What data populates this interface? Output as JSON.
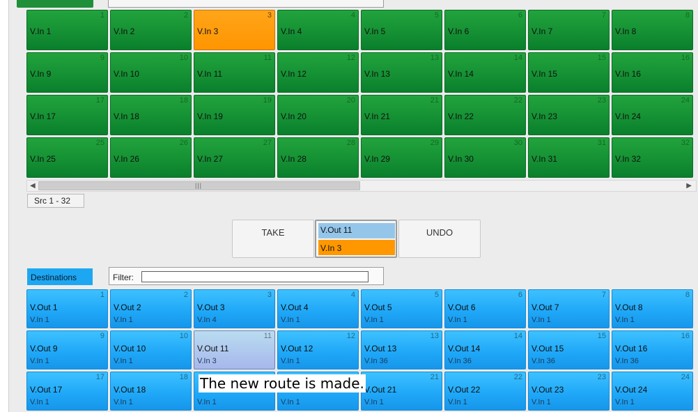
{
  "sources": {
    "page_tab": "Src 1 - 32",
    "tiles": [
      {
        "num": "1",
        "label": "V.In 1"
      },
      {
        "num": "2",
        "label": "V.In 2"
      },
      {
        "num": "3",
        "label": "V.In 3",
        "selected": true
      },
      {
        "num": "4",
        "label": "V.In 4"
      },
      {
        "num": "5",
        "label": "V.In 5"
      },
      {
        "num": "6",
        "label": "V.In 6"
      },
      {
        "num": "7",
        "label": "V.In 7"
      },
      {
        "num": "8",
        "label": "V.In 8"
      },
      {
        "num": "9",
        "label": "V.In 9"
      },
      {
        "num": "10",
        "label": "V.In 10"
      },
      {
        "num": "11",
        "label": "V.In 11"
      },
      {
        "num": "12",
        "label": "V.In 12"
      },
      {
        "num": "13",
        "label": "V.In 13"
      },
      {
        "num": "14",
        "label": "V.In 14"
      },
      {
        "num": "15",
        "label": "V.In 15"
      },
      {
        "num": "16",
        "label": "V.In 16"
      },
      {
        "num": "17",
        "label": "V.In 17"
      },
      {
        "num": "18",
        "label": "V.In 18"
      },
      {
        "num": "19",
        "label": "V.In 19"
      },
      {
        "num": "20",
        "label": "V.In 20"
      },
      {
        "num": "21",
        "label": "V.In 21"
      },
      {
        "num": "22",
        "label": "V.In 22"
      },
      {
        "num": "23",
        "label": "V.In 23"
      },
      {
        "num": "24",
        "label": "V.In 24"
      },
      {
        "num": "25",
        "label": "V.In 25"
      },
      {
        "num": "26",
        "label": "V.In 26"
      },
      {
        "num": "27",
        "label": "V.In 27"
      },
      {
        "num": "28",
        "label": "V.In 28"
      },
      {
        "num": "29",
        "label": "V.In 29"
      },
      {
        "num": "30",
        "label": "V.In 30"
      },
      {
        "num": "31",
        "label": "V.In 31"
      },
      {
        "num": "32",
        "label": "V.In 32"
      }
    ]
  },
  "take_panel": {
    "take_label": "TAKE",
    "undo_label": "UNDO",
    "preview_dest": "V.Out 11",
    "preview_src": "V.In 3"
  },
  "destinations": {
    "tab_label": "Destinations",
    "filter_label": "Filter:",
    "filter_value": "",
    "tiles": [
      {
        "num": "1",
        "name": "V.Out 1",
        "src": "V.In 1"
      },
      {
        "num": "2",
        "name": "V.Out 2",
        "src": "V.In 1"
      },
      {
        "num": "3",
        "name": "V.Out 3",
        "src": "V.In 4"
      },
      {
        "num": "4",
        "name": "V.Out 4",
        "src": "V.In 1"
      },
      {
        "num": "5",
        "name": "V.Out 5",
        "src": "V.In 1"
      },
      {
        "num": "6",
        "name": "V.Out 6",
        "src": "V.In 1"
      },
      {
        "num": "7",
        "name": "V.Out 7",
        "src": "V.In 1"
      },
      {
        "num": "8",
        "name": "V.Out 8",
        "src": "V.In 1"
      },
      {
        "num": "9",
        "name": "V.Out 9",
        "src": "V.In 1"
      },
      {
        "num": "10",
        "name": "V.Out 10",
        "src": "V.In 1"
      },
      {
        "num": "11",
        "name": "V.Out 11",
        "src": "V.In 3",
        "selected": true
      },
      {
        "num": "12",
        "name": "V.Out 12",
        "src": "V.In 1"
      },
      {
        "num": "13",
        "name": "V.Out 13",
        "src": "V.In 36"
      },
      {
        "num": "14",
        "name": "V.Out 14",
        "src": "V.In 36"
      },
      {
        "num": "15",
        "name": "V.Out 15",
        "src": "V.In 36"
      },
      {
        "num": "16",
        "name": "V.Out 16",
        "src": "V.In 36"
      },
      {
        "num": "17",
        "name": "V.Out 17",
        "src": "V.In 1"
      },
      {
        "num": "18",
        "name": "V.Out 18",
        "src": "V.In 1"
      },
      {
        "num": "",
        "name": "",
        "src": "V.In 1"
      },
      {
        "num": "",
        "name": "",
        "src": "V.In 1"
      },
      {
        "num": "21",
        "name": "V.Out 21",
        "src": "V.In 1"
      },
      {
        "num": "22",
        "name": "V.Out 22",
        "src": "V.In 1"
      },
      {
        "num": "23",
        "name": "V.Out 23",
        "src": "V.In 1"
      },
      {
        "num": "24",
        "name": "V.Out 24",
        "src": "V.In 1"
      }
    ]
  },
  "caption": "The new route is made.",
  "colors": {
    "source_tile": "#159134",
    "source_selected": "#ff9800",
    "dest_tile": "#1ea6f7",
    "dest_selected": "#b3c9ee",
    "preview_dest": "#95c6ea",
    "preview_src": "#ff9800"
  },
  "icons": {
    "scroll_left": "◀",
    "scroll_right": "▶",
    "scroll_grip": "|||"
  }
}
